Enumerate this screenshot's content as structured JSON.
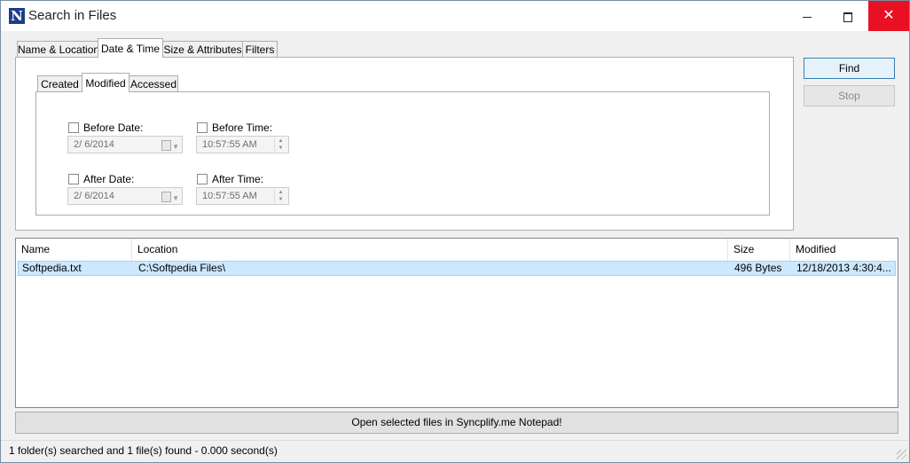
{
  "window": {
    "title": "Search in Files",
    "icon": "N"
  },
  "tabs": [
    "Name & Location",
    "Date & Time",
    "Size & Attributes",
    "Filters"
  ],
  "subtabs": [
    "Created",
    "Modified",
    "Accessed"
  ],
  "filters": {
    "before_date_label": "Before Date:",
    "before_date_value": "2/  6/2014",
    "before_time_label": "Before Time:",
    "before_time_value": "10:57:55 AM",
    "after_date_label": "After Date:",
    "after_date_value": "2/  6/2014",
    "after_time_label": "After Time:",
    "after_time_value": "10:57:55 AM"
  },
  "buttons": {
    "find": "Find",
    "stop": "Stop"
  },
  "results": {
    "columns": [
      "Name",
      "Location",
      "Size",
      "Modified"
    ],
    "rows": [
      {
        "name": "Softpedia.txt",
        "location": "C:\\Softpedia Files\\",
        "size": "496 Bytes",
        "modified": "12/18/2013 4:30:4..."
      }
    ]
  },
  "open_button": "Open selected files in Syncplify.me Notepad!",
  "status": "1 folder(s) searched and 1 file(s) found - 0.000 second(s)",
  "colors": {
    "selection": "#cce8ff",
    "close": "#e81123",
    "icon_bg": "#1f3c88"
  }
}
